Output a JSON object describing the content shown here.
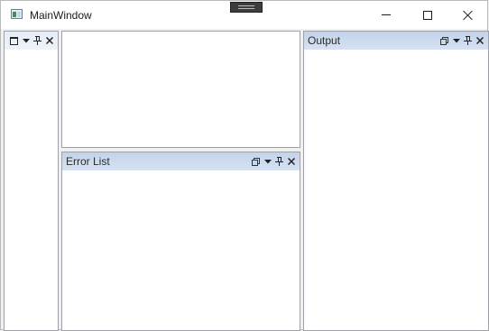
{
  "window": {
    "title": "MainWindow",
    "buttons": [
      "minimize",
      "maximize",
      "close"
    ]
  },
  "panes": {
    "left": {
      "title": "",
      "tools": [
        "window-position-icon",
        "dropdown-icon",
        "pin-icon",
        "close-icon"
      ]
    },
    "document": {
      "title": ""
    },
    "error_list": {
      "title": "Error List",
      "tools": [
        "float-icon",
        "dropdown-icon",
        "pin-icon",
        "close-icon"
      ]
    },
    "output": {
      "title": "Output",
      "tools": [
        "float-icon",
        "dropdown-icon",
        "pin-icon",
        "close-icon"
      ]
    }
  },
  "colors": {
    "header_active": "#c2d3ea",
    "pane_border": "#9ea2a8",
    "background": "#f0f0f0"
  }
}
